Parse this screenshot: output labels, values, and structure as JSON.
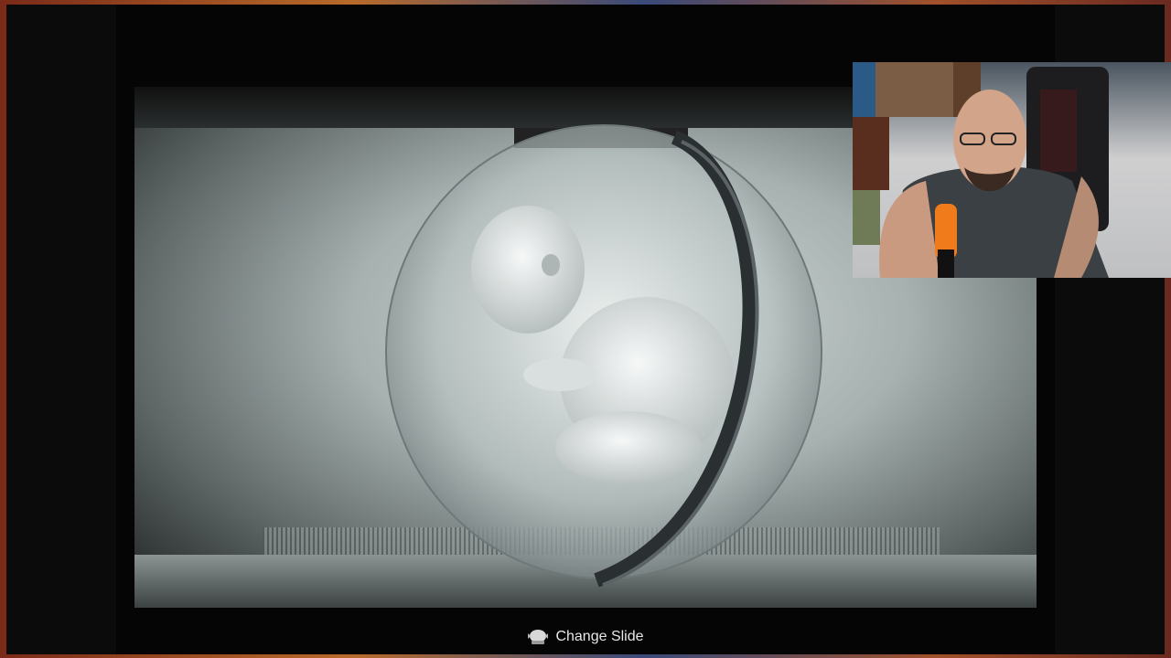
{
  "game": {
    "prompt": {
      "button_icon": "touchpad-icon",
      "label": "Change Slide"
    }
  },
  "webcam": {
    "icon": "streamer-webcam"
  },
  "colors": {
    "prompt_text": "#e8e8e8",
    "mic_orange": "#f07b1a"
  }
}
